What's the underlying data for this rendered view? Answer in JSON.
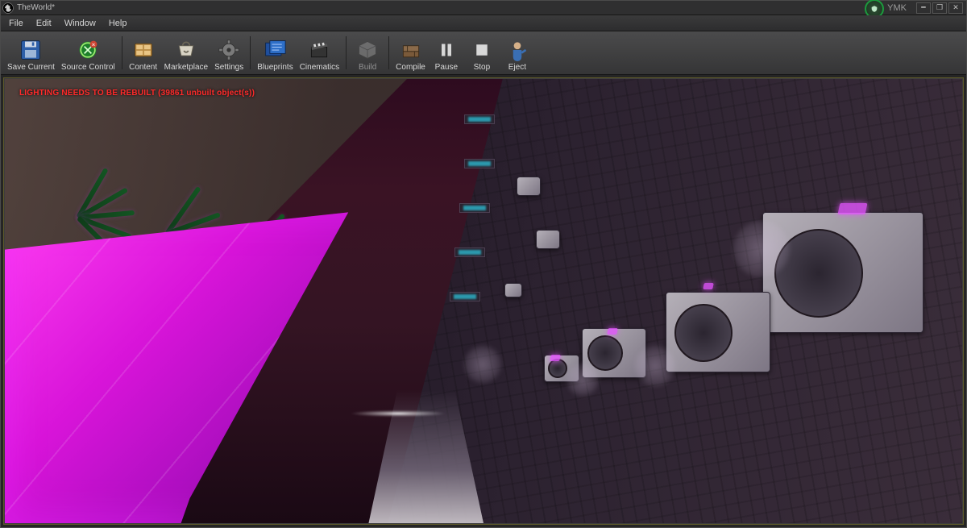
{
  "window": {
    "title": "TheWorld*",
    "user": "YMK"
  },
  "menu": {
    "items": [
      "File",
      "Edit",
      "Window",
      "Help"
    ]
  },
  "toolbar": {
    "save": {
      "label": "Save Current"
    },
    "sourceControl": {
      "label": "Source Control"
    },
    "content": {
      "label": "Content"
    },
    "marketplace": {
      "label": "Marketplace"
    },
    "settings": {
      "label": "Settings"
    },
    "blueprints": {
      "label": "Blueprints"
    },
    "cinematics": {
      "label": "Cinematics"
    },
    "build": {
      "label": "Build"
    },
    "compile": {
      "label": "Compile"
    },
    "pause": {
      "label": "Pause"
    },
    "stop": {
      "label": "Stop"
    },
    "eject": {
      "label": "Eject"
    }
  },
  "viewport": {
    "warning": "LIGHTING NEEDS TO BE REBUILT (39861 unbuilt object(s))"
  },
  "colors": {
    "neon": "#e82bff",
    "warning": "#ff2a2a"
  }
}
